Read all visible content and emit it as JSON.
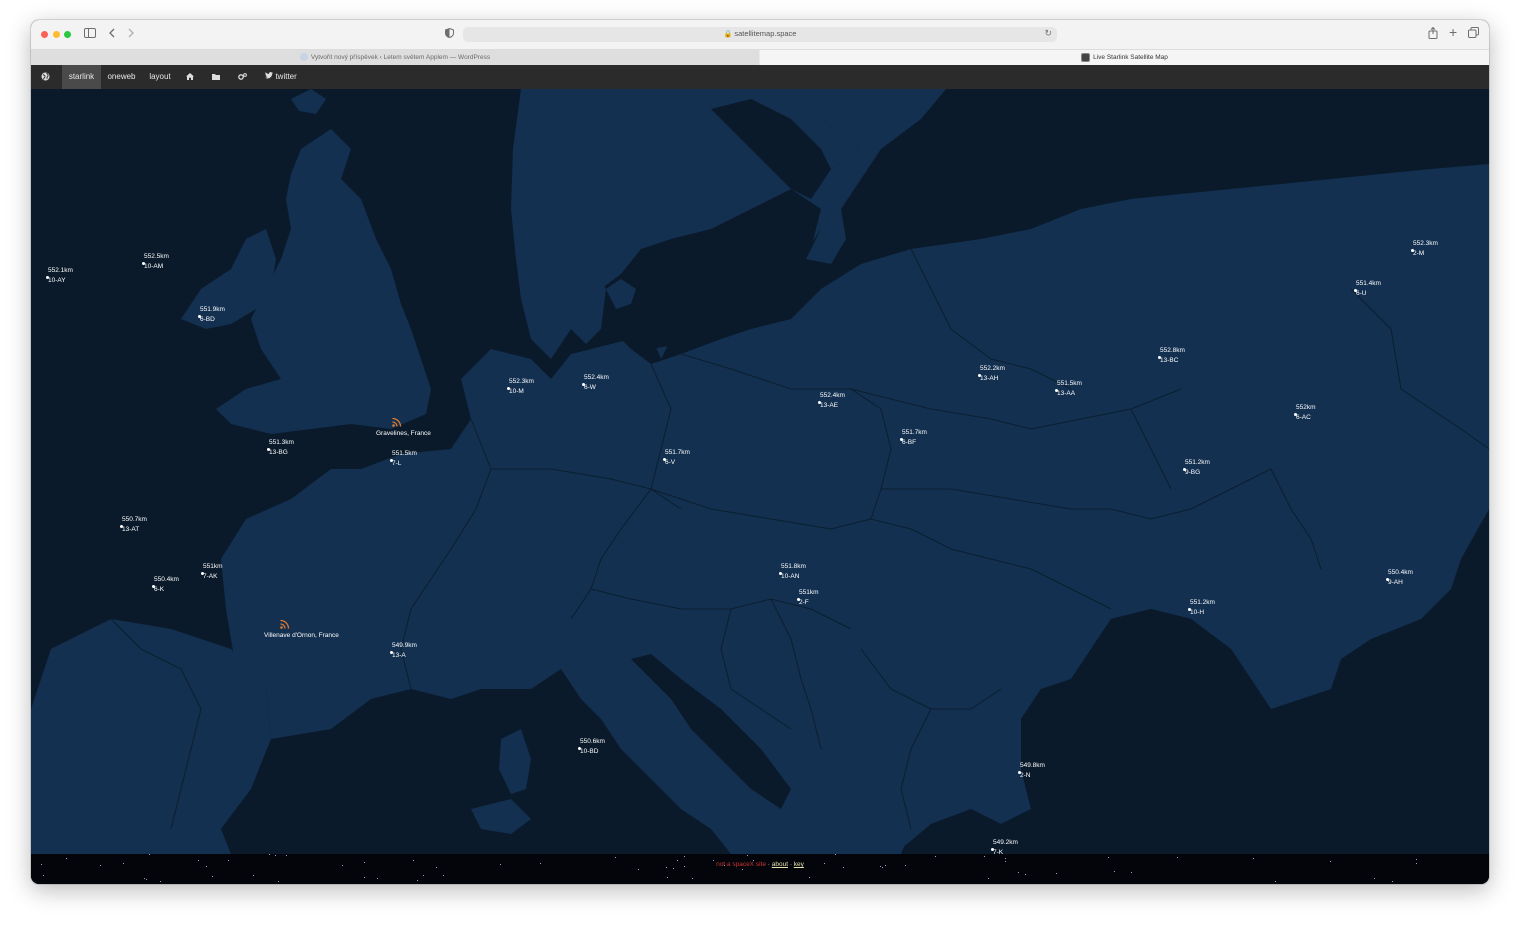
{
  "browser": {
    "url": "satellitemap.space",
    "tabs": [
      {
        "title": "Vytvořit nový příspěvek ‹ Letem světem Applem — WordPress",
        "active": false
      },
      {
        "title": "Live Starlink Satellite Map",
        "active": true
      }
    ]
  },
  "nav": {
    "globe_icon": "globe-icon",
    "items": [
      {
        "label": "starlink",
        "active": true
      },
      {
        "label": "oneweb",
        "active": false
      },
      {
        "label": "layout",
        "active": false
      }
    ],
    "home_icon": "home-icon",
    "folder_icon": "folder-icon",
    "settings_icon": "cogs-icon",
    "twitter_label": "twitter"
  },
  "map": {
    "water_color": "#0a1a2b",
    "land_color": "#123050",
    "satellites": [
      {
        "alt": "552.1km",
        "id": "10-AY"
      },
      {
        "alt": "552.5km",
        "id": "10-AM"
      },
      {
        "alt": "551.9km",
        "id": "6-BD"
      },
      {
        "alt": "551.3km",
        "id": "13-BG"
      },
      {
        "alt": "550.7km",
        "id": "13-AT"
      },
      {
        "alt": "551km",
        "id": "7-AK"
      },
      {
        "alt": "550.4km",
        "id": "6-K"
      },
      {
        "alt": "551.5km",
        "id": "7-L"
      },
      {
        "alt": "549.9km",
        "id": "13-A"
      },
      {
        "alt": "552.3km",
        "id": "10-M"
      },
      {
        "alt": "552.4km",
        "id": "6-W"
      },
      {
        "alt": "551.7km",
        "id": "6-V"
      },
      {
        "alt": "552.4km",
        "id": "13-AE"
      },
      {
        "alt": "551.7km",
        "id": "6-BF"
      },
      {
        "alt": "551.8km",
        "id": "10-AN"
      },
      {
        "alt": "551km",
        "id": "2-F"
      },
      {
        "alt": "550.6km",
        "id": "10-BD"
      },
      {
        "alt": "552.2km",
        "id": "13-AH"
      },
      {
        "alt": "551.5km",
        "id": "13-AA"
      },
      {
        "alt": "552.8km",
        "id": "13-BC"
      },
      {
        "alt": "552km",
        "id": "6-AC"
      },
      {
        "alt": "551.2km",
        "id": "9-BG"
      },
      {
        "alt": "551.2km",
        "id": "10-H"
      },
      {
        "alt": "549.8km",
        "id": "2-N"
      },
      {
        "alt": "549.2km",
        "id": "7-K"
      },
      {
        "alt": "552.3km",
        "id": "2-M"
      },
      {
        "alt": "551.4km",
        "id": "6-U"
      },
      {
        "alt": "550.4km",
        "id": "9-AH"
      }
    ],
    "ground_stations": [
      {
        "name": "Gravelines, France"
      },
      {
        "name": "Villenave d'Ornon, France"
      }
    ]
  },
  "footer": {
    "notice": "not a spaceX site",
    "sep1": " · ",
    "about": "about",
    "sep2": " · ",
    "key": "key"
  }
}
